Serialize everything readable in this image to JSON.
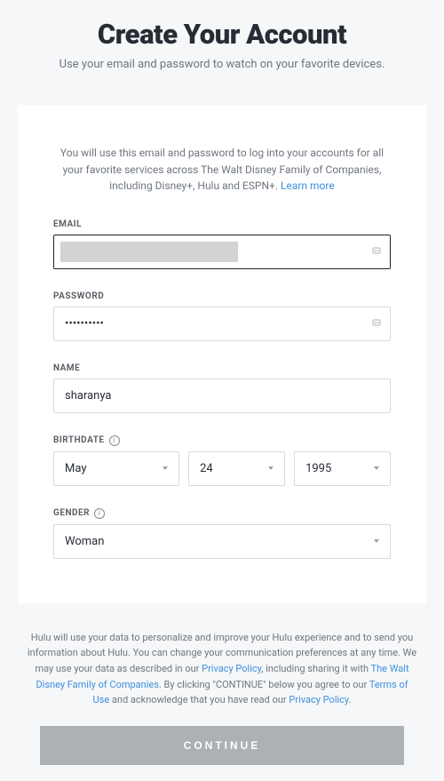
{
  "header": {
    "title": "Create Your Account",
    "subtitle": "Use your email and password to watch on your favorite devices."
  },
  "card": {
    "intro_text": "You will use this email and password to log into your accounts for all your favorite services across The Walt Disney Family of Companies, including Disney+, Hulu and ESPN+. ",
    "learn_more": "Learn more"
  },
  "fields": {
    "email": {
      "label": "EMAIL",
      "value": ""
    },
    "password": {
      "label": "PASSWORD",
      "value": "••••••••••"
    },
    "name": {
      "label": "NAME",
      "value": "sharanya"
    },
    "birthdate": {
      "label": "BIRTHDATE",
      "month": "May",
      "day": "24",
      "year": "1995"
    },
    "gender": {
      "label": "GENDER",
      "value": "Woman"
    }
  },
  "legal": {
    "part1": "Hulu will use your data to personalize and improve your Hulu experience and to send you information about Hulu. You can change your communication preferences at any time. We may use your data as described in our ",
    "privacy_policy": "Privacy Policy",
    "part2": ", including sharing it with ",
    "disney_family": "The Walt Disney Family of Companies",
    "part3": ". By clicking \"CONTINUE\" below you agree to our ",
    "terms": "Terms of Use",
    "part4": " and acknowledge that you have read our ",
    "privacy_policy2": "Privacy Policy",
    "part5": "."
  },
  "continue_label": "CONTINUE"
}
